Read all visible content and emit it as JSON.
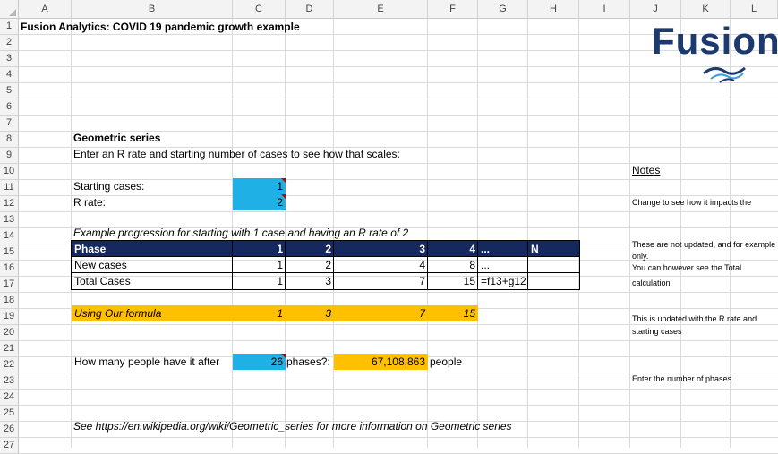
{
  "columns": [
    "A",
    "B",
    "C",
    "D",
    "E",
    "F",
    "G",
    "H",
    "I",
    "J",
    "K",
    "L"
  ],
  "rows": [
    "1",
    "2",
    "3",
    "4",
    "5",
    "6",
    "7",
    "8",
    "9",
    "10",
    "11",
    "12",
    "13",
    "14",
    "15",
    "16",
    "17",
    "18",
    "19",
    "20",
    "21",
    "22",
    "23",
    "24",
    "25",
    "26",
    "27"
  ],
  "title": "Fusion Analytics: COVID 19 pandemic growth example",
  "logo_text": "Fusion",
  "geometric": {
    "heading": "Geometric series",
    "instruction": "Enter an R rate and starting number of cases to see how that scales:",
    "starting_label": "Starting cases:",
    "starting_value": "1",
    "rrate_label": "R rate:",
    "rrate_value": "2"
  },
  "example_caption": "Example progression for starting with 1 case and having an R rate of 2",
  "table": {
    "header": [
      "Phase",
      "1",
      "2",
      "3",
      "4",
      "...",
      "N"
    ],
    "new_cases": [
      "New cases",
      "1",
      "2",
      "4",
      "8",
      "...",
      ""
    ],
    "total_cases": [
      "Total Cases",
      "1",
      "3",
      "7",
      "15",
      "=f13+g12",
      ""
    ]
  },
  "formula_row": [
    "Using Our formula",
    "1",
    "3",
    "7",
    "15"
  ],
  "phases_row": {
    "label": "How many people have it after",
    "phases": "26",
    "phases_suffix": "phases?:",
    "result": "67,108,863",
    "result_suffix": "people"
  },
  "footnote": "See https://en.wikipedia.org/wiki/Geometric_series for more information on Geometric series",
  "notes": {
    "heading": "Notes",
    "note1": "Change to see how it impacts the",
    "note2_line1": "These are not updated, and for example",
    "note2_line2": "only.",
    "note2_line3": "You can however see the Total",
    "note2_line4": "calculation",
    "note3_line1": "This is updated with the R rate and",
    "note3_line2": "starting cases",
    "note4": "Enter the number of phases"
  },
  "colors": {
    "blue": "#1fb1e6",
    "gold": "#ffc000",
    "navy": "#16295e",
    "logo_navy": "#1d3a6e"
  }
}
